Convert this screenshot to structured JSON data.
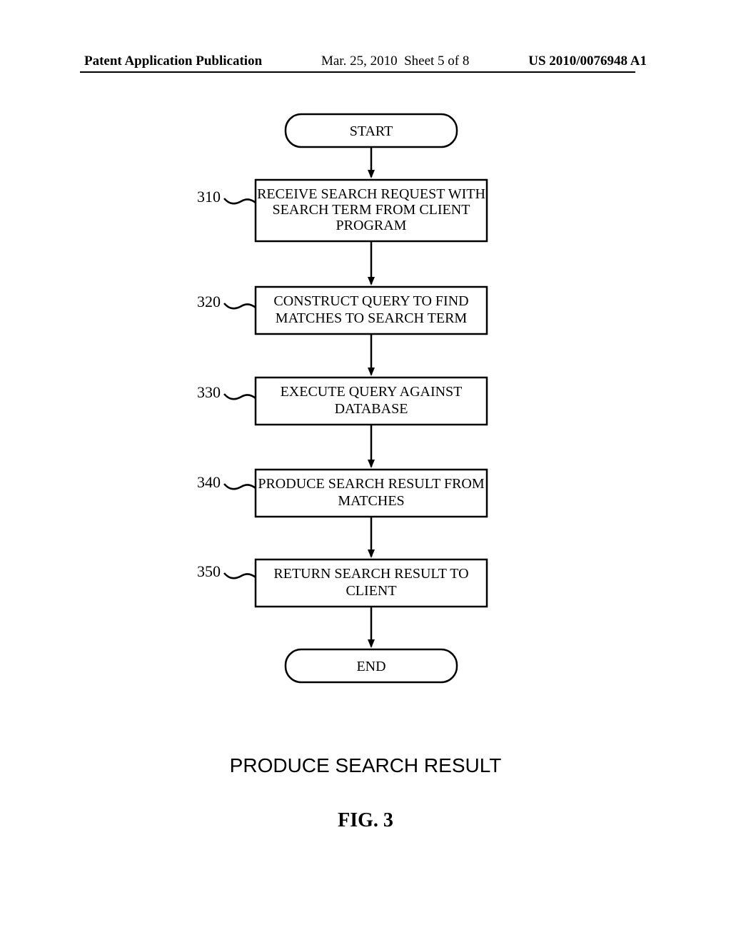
{
  "header": {
    "left": "Patent Application Publication",
    "date": "Mar. 25, 2010",
    "sheet": "Sheet 5 of 8",
    "pubnum": "US 2010/0076948 A1"
  },
  "flow": {
    "start": "START",
    "end": "END",
    "steps": [
      {
        "ref": "310",
        "lines": [
          "RECEIVE SEARCH REQUEST WITH",
          "SEARCH TERM FROM CLIENT",
          "PROGRAM"
        ]
      },
      {
        "ref": "320",
        "lines": [
          "CONSTRUCT QUERY TO FIND",
          "MATCHES TO SEARCH TERM"
        ]
      },
      {
        "ref": "330",
        "lines": [
          "EXECUTE QUERY AGAINST",
          "DATABASE"
        ]
      },
      {
        "ref": "340",
        "lines": [
          "PRODUCE SEARCH RESULT FROM",
          "MATCHES"
        ]
      },
      {
        "ref": "350",
        "lines": [
          "RETURN SEARCH RESULT TO",
          "CLIENT"
        ]
      }
    ]
  },
  "caption": "PRODUCE SEARCH RESULT",
  "figure_label": "FIG. 3"
}
